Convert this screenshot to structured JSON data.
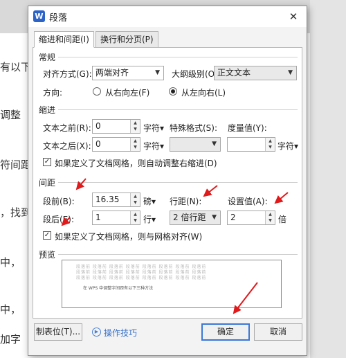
{
  "background_doc": {
    "lines": [
      "有以下",
      "调整",
      "符间距",
      "，找到",
      "中，",
      "中，",
      "加字"
    ]
  },
  "dialog": {
    "app_icon": "W",
    "title": "段落",
    "close_glyph": "✕",
    "tabs": [
      {
        "label": "缩进和间距(I)",
        "active": true
      },
      {
        "label": "换行和分页(P)",
        "active": false
      }
    ],
    "general": {
      "heading": "常规",
      "alignment_label": "对齐方式(G):",
      "alignment_value": "两端对齐",
      "outline_label": "大纲级别(O):",
      "outline_value": "正文文本",
      "direction_label": "方向:",
      "rtl_label": "从右向左(F)",
      "ltr_label": "从左向右(L)",
      "direction_selected": "ltr"
    },
    "indent": {
      "heading": "缩进",
      "before_label": "文本之前(R):",
      "before_value": "0",
      "before_unit": "字符▾",
      "after_label": "文本之后(X):",
      "after_value": "0",
      "after_unit": "字符▾",
      "special_label": "特殊格式(S):",
      "special_value": "",
      "measure_label": "度量值(Y):",
      "measure_value": "",
      "measure_unit": "字符▾",
      "auto_adjust_label": "如果定义了文档网格，则自动调整右缩进(D)",
      "auto_adjust_checked": true
    },
    "spacing": {
      "heading": "间距",
      "before_label": "段前(B):",
      "before_value": "16.35",
      "before_unit": "磅▾",
      "after_label": "段后(E):",
      "after_value": "1",
      "after_unit": "行▾",
      "line_label": "行距(N):",
      "line_value": "2 倍行距",
      "setting_label": "设置值(A):",
      "setting_value": "2",
      "setting_unit": "倍",
      "snap_grid_label": "如果定义了文档网格，则与网格对齐(W)",
      "snap_grid_checked": true
    },
    "preview": {
      "heading": "预览",
      "filler_text": "段落前 段落前 段落前 段落前 段落前 段落前 段落前 段落前",
      "sample_text": "在 WPS 中调整字间距有以下三种方法"
    },
    "footer": {
      "tabs_button": "制表位(T)...",
      "tips_label": "操作技巧",
      "ok_button": "确定",
      "cancel_button": "取消"
    }
  },
  "colors": {
    "annotation_arrow": "#e0191b",
    "accent_blue": "#3b77d6"
  }
}
